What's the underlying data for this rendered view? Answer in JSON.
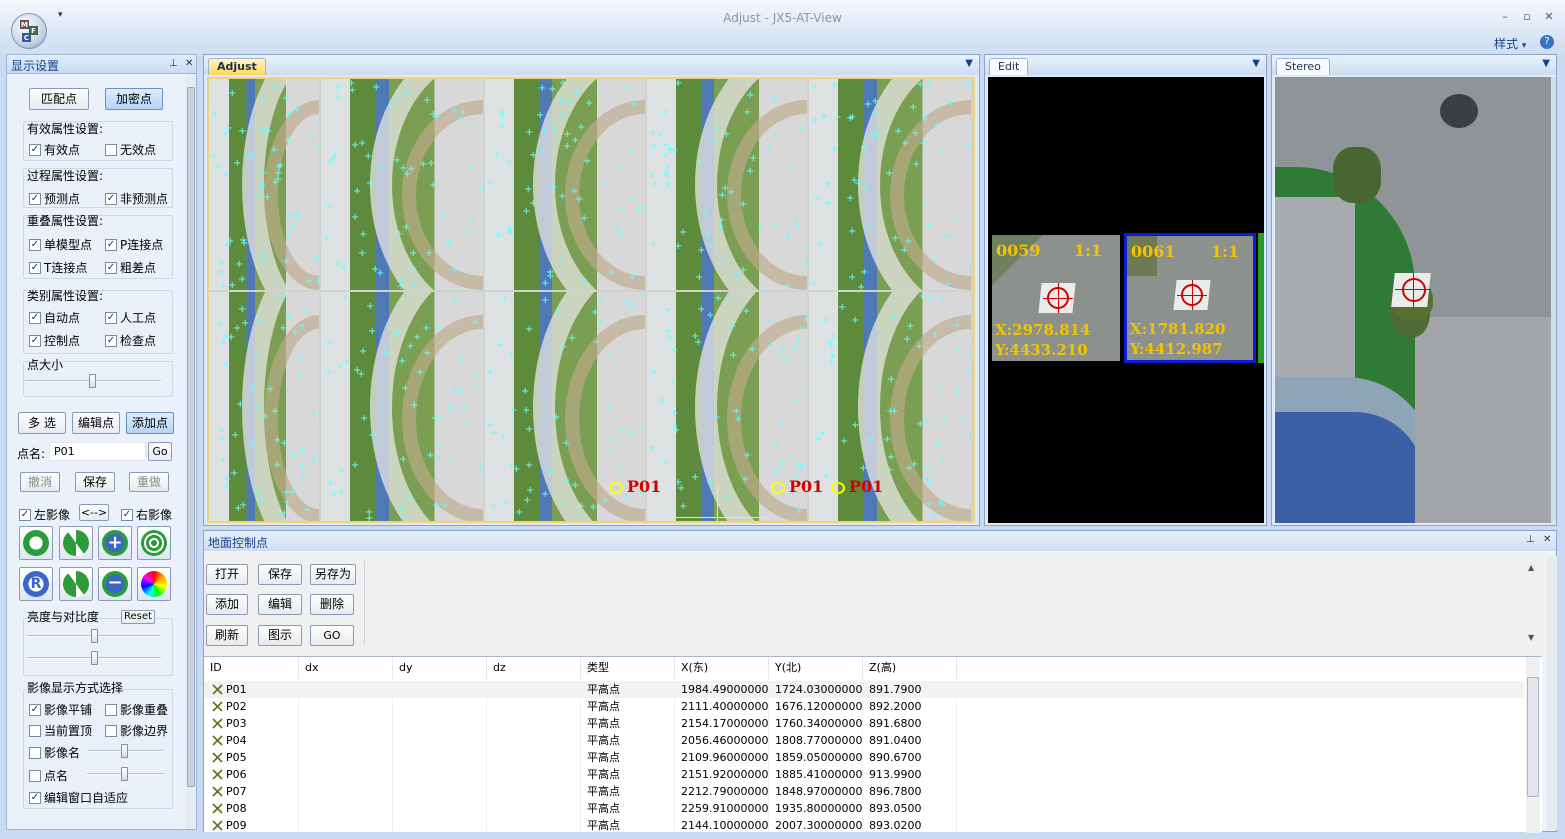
{
  "window": {
    "title": "Adjust - JX5-AT-View",
    "style_menu": "样式",
    "qat_arrow": "▾",
    "min": "–",
    "restore": "▫",
    "close": "✕"
  },
  "logo": {
    "letters": [
      "M",
      "F",
      "C"
    ]
  },
  "left_panel": {
    "title": "显示设置",
    "btn_match": "匹配点",
    "btn_densify": "加密点",
    "valid_group": {
      "title": "有效属性设置:",
      "items": [
        "有效点",
        "无效点"
      ]
    },
    "process_group": {
      "title": "过程属性设置:",
      "items": [
        "预测点",
        "非预测点"
      ]
    },
    "overlap_group": {
      "title": "重叠属性设置:",
      "items": [
        "单模型点",
        "P连接点",
        "T连接点",
        "粗差点"
      ]
    },
    "class_group": {
      "title": "类别属性设置:",
      "items": [
        "自动点",
        "人工点",
        "控制点",
        "检查点"
      ]
    },
    "point_size": "点大小",
    "btn_multi": "多 选",
    "btn_edit": "编辑点",
    "btn_add": "添加点",
    "point_name_label": "点名:",
    "point_name_value": "P01",
    "btn_go": "Go",
    "btn_undo": "撤消",
    "btn_save": "保存",
    "btn_redo": "重做",
    "left_image": "左影像",
    "swap": "<-->",
    "right_image": "右影像",
    "brightness": "亮度与对比度",
    "reset": "Reset",
    "display_group": {
      "title": "影像显示方式选择",
      "items": [
        "影像平铺",
        "影像重叠",
        "当前置顶",
        "影像边界",
        "影像名",
        "点名",
        "编辑窗口自适应"
      ]
    }
  },
  "panes": {
    "adjust": {
      "tab": "Adjust",
      "labels": [
        "P01",
        "P01",
        "P01"
      ]
    },
    "edit": {
      "tab": "Edit",
      "tiles": [
        {
          "id": "0059",
          "ratio": "1:1",
          "x": "X:2978.814",
          "y": "Y:4433.210"
        },
        {
          "id": "0061",
          "ratio": "1:1",
          "x": "X:1781.820",
          "y": "Y:4412.987"
        }
      ]
    },
    "stereo": {
      "tab": "Stereo"
    }
  },
  "gcp": {
    "title": "地面控制点",
    "buttons": [
      "打开",
      "保存",
      "另存为",
      "添加",
      "编辑",
      "删除",
      "刷新",
      "图示",
      "GO"
    ],
    "columns": [
      "ID",
      "dx",
      "dy",
      "dz",
      "类型",
      "X(东)",
      "Y(北)",
      "Z(高)"
    ],
    "rows": [
      [
        "P01",
        "",
        "",
        "",
        "平高点",
        "1984.49000000",
        "1724.03000000",
        "891.7900"
      ],
      [
        "P02",
        "",
        "",
        "",
        "平高点",
        "2111.40000000",
        "1676.12000000",
        "892.2000"
      ],
      [
        "P03",
        "",
        "",
        "",
        "平高点",
        "2154.17000000",
        "1760.34000000",
        "891.6800"
      ],
      [
        "P04",
        "",
        "",
        "",
        "平高点",
        "2056.46000000",
        "1808.77000000",
        "891.0400"
      ],
      [
        "P05",
        "",
        "",
        "",
        "平高点",
        "2109.96000000",
        "1859.05000000",
        "890.6700"
      ],
      [
        "P06",
        "",
        "",
        "",
        "平高点",
        "2151.92000000",
        "1885.41000000",
        "913.9900"
      ],
      [
        "P07",
        "",
        "",
        "",
        "平高点",
        "2212.79000000",
        "1848.97000000",
        "896.7800"
      ],
      [
        "P08",
        "",
        "",
        "",
        "平高点",
        "2259.91000000",
        "1935.80000000",
        "893.0500"
      ],
      [
        "P09",
        "",
        "",
        "",
        "平高点",
        "2144.10000000",
        "2007.30000000",
        "893.0200"
      ]
    ]
  }
}
